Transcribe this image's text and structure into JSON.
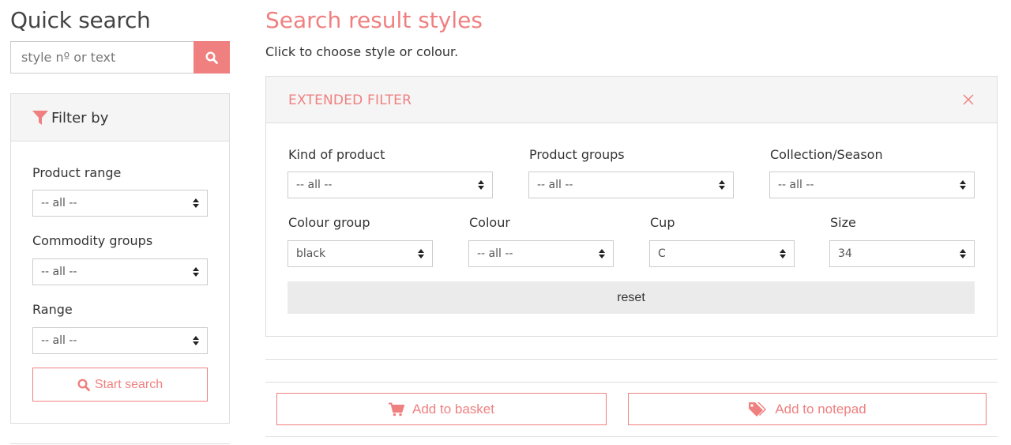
{
  "quick_search": {
    "title": "Quick search",
    "placeholder": "style nº or text"
  },
  "filter": {
    "header": "Filter by",
    "product_range": {
      "label": "Product range",
      "value": "-- all --"
    },
    "commodity_groups": {
      "label": "Commodity groups",
      "value": "-- all --"
    },
    "range": {
      "label": "Range",
      "value": "-- all --"
    },
    "start_search_label": "Start search"
  },
  "results": {
    "title": "Search result styles",
    "subtitle": "Click to choose style or colour."
  },
  "extended_filter": {
    "header": "EXTENDED FILTER",
    "kind_of_product": {
      "label": "Kind of product",
      "value": "-- all --"
    },
    "product_groups": {
      "label": "Product groups",
      "value": "-- all --"
    },
    "collection_season": {
      "label": "Collection/Season",
      "value": "-- all --"
    },
    "colour_group": {
      "label": "Colour group",
      "value": "black"
    },
    "colour": {
      "label": "Colour",
      "value": "-- all --"
    },
    "cup": {
      "label": "Cup",
      "value": "C"
    },
    "size": {
      "label": "Size",
      "value": "34"
    },
    "reset_label": "reset"
  },
  "actions": {
    "add_to_basket": "Add to basket",
    "add_to_notepad": "Add to notepad"
  },
  "colors": {
    "accent": "#f08080",
    "panel_header_bg": "#f5f5f5",
    "border": "#dddddd",
    "reset_bg": "#ebebeb"
  },
  "icons": {
    "search_button": "search-icon",
    "filter_header": "filter-icon",
    "start_search": "search-icon",
    "close_filter": "close-icon",
    "add_to_basket": "cart-icon",
    "add_to_notepad": "tags-icon"
  }
}
